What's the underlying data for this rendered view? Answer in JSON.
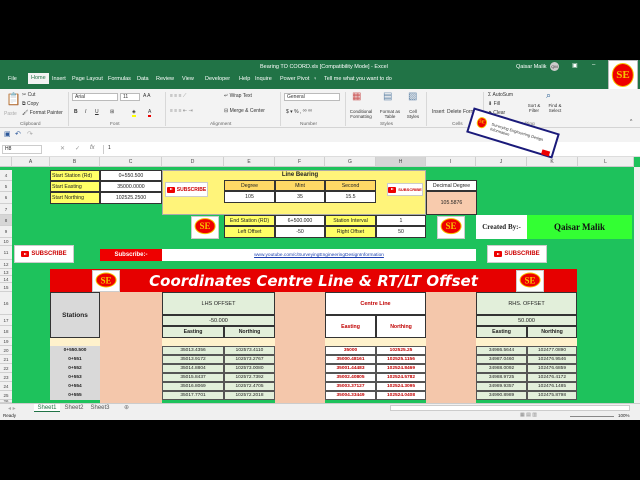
{
  "window": {
    "title": "Bearing TO COORD.xls  [Compatibility Mode]  -  Excel",
    "user": "Qaisar Malik",
    "user_initials": "QM"
  },
  "menu_tabs": [
    "File",
    "Home",
    "Insert",
    "Page Layout",
    "Formulas",
    "Data",
    "Review",
    "View",
    "Developer",
    "Help",
    "Inquire",
    "Power Pivot"
  ],
  "tell_me": "Tell me what you want to do",
  "ribbon": {
    "clipboard": {
      "paste": "Paste",
      "cut": "Cut",
      "copy": "Copy",
      "format_painter": "Format Painter",
      "label": "Clipboard"
    },
    "font": {
      "name": "Arial",
      "size": "11",
      "label": "Font"
    },
    "alignment": {
      "wrap": "Wrap Text",
      "merge": "Merge & Center",
      "label": "Alignment"
    },
    "number": {
      "format": "General",
      "label": "Number"
    },
    "styles": {
      "conditional": "Conditional Formatting",
      "format_table": "Format as Table",
      "cell_styles": "Cell Styles",
      "label": "Styles"
    },
    "cells": {
      "insert": "Insert",
      "delete": "Delete",
      "format": "Format",
      "label": "Cells"
    },
    "editing": {
      "autosum": "AutoSum",
      "fill": "Fill",
      "clear": "Clear",
      "sort": "Sort & Filter",
      "find": "Find & Select",
      "label": "Editing"
    }
  },
  "formula_bar": {
    "name_box": "H8",
    "value": "1"
  },
  "columns": [
    "A",
    "B",
    "C",
    "D",
    "E",
    "F",
    "G",
    "H",
    "I",
    "J",
    "K",
    "L"
  ],
  "rows": [
    "4",
    "5",
    "6",
    "7",
    "8",
    "9",
    "10",
    "11",
    "12",
    "13",
    "14",
    "15",
    "16",
    "17",
    "18",
    "19",
    "20",
    "21",
    "22",
    "23",
    "24",
    "25",
    "26"
  ],
  "inputs": {
    "start_station_label": "Start Station (Rd)",
    "start_station": "0+550.500",
    "start_easting_label": "Start Easting",
    "start_easting": "35000.0000",
    "start_northing_label": "Start Northing",
    "start_northing": "102525.2500",
    "line_bearing": "Line Bearing",
    "degree_label": "Degree",
    "mint_label": "Mint",
    "second_label": "Second",
    "degree": "105",
    "mint": "35",
    "second": "15.5",
    "decimal_degree_label": "Decimal Degree",
    "decimal_degree": "105.5876",
    "end_station_label": "End Station (RD)",
    "end_station": "6+500.000",
    "station_interval_label": "Station Interval",
    "station_interval": "1",
    "left_offset_label": "Left Offset",
    "left_offset": "-50",
    "right_offset_label": "Right Offset",
    "right_offset": "50",
    "created_by_label": "Created By:-",
    "created_by": "Qaisar Malik",
    "subscribe_label": "Subscribe:-",
    "subscribe_url": "www.youtube.com/c/SurveyingEngineeringDesignInformation",
    "subscribe_button": "SUBSCRIBE"
  },
  "logo_text": "SE",
  "ad_text": "Surveying Engineering Design Information",
  "table": {
    "title": "Coordinates Centre Line & RT/LT Offset",
    "stations_header": "Stations",
    "lhs_header": "LHS OFFSET",
    "lhs_offset": "-50.000",
    "centre_header": "Centre Line",
    "rhs_header": "RHS. OFFSET",
    "rhs_offset": "50.000",
    "easting": "Easting",
    "northing": "Northing",
    "rows": [
      {
        "station": "0+550.500",
        "lhs_e": "35013.4356",
        "lhs_n": "102573.4110",
        "cl_e": "35000",
        "cl_n": "102525.25",
        "rhs_e": "34986.5644",
        "rhs_n": "102477.0890"
      },
      {
        "station": "0+551",
        "lhs_e": "35013.9172",
        "lhs_n": "102573.2767",
        "cl_e": "35000.48161",
        "cl_n": "102525.1156",
        "rhs_e": "34987.0460",
        "rhs_n": "102476.9546"
      },
      {
        "station": "0+552",
        "lhs_e": "35014.8804",
        "lhs_n": "102573.0080",
        "cl_e": "35001.44483",
        "cl_n": "102524.8469",
        "rhs_e": "34988.0092",
        "rhs_n": "102476.6859"
      },
      {
        "station": "0+553",
        "lhs_e": "35015.8437",
        "lhs_n": "102572.7392",
        "cl_e": "35002.40805",
        "cl_n": "102524.5782",
        "rhs_e": "34988.9725",
        "rhs_n": "102476.4172"
      },
      {
        "station": "0+554",
        "lhs_e": "35016.8069",
        "lhs_n": "102572.4705",
        "cl_e": "35003.37127",
        "cl_n": "102524.3095",
        "rhs_e": "34989.9357",
        "rhs_n": "102476.1485"
      },
      {
        "station": "0+555",
        "lhs_e": "35017.7701",
        "lhs_n": "102572.2018",
        "cl_e": "35004.33449",
        "cl_n": "102524.0408",
        "rhs_e": "34990.8989",
        "rhs_n": "102475.8798"
      }
    ]
  },
  "sheets": [
    "Sheet1",
    "Sheet2",
    "Sheet3"
  ],
  "status": {
    "ready": "Ready",
    "zoom": "100%"
  },
  "colors": {
    "excel_green": "#217346",
    "sheet_green": "#1ec25c",
    "banner_red": "#e60000",
    "centre_text": "#c00000"
  }
}
